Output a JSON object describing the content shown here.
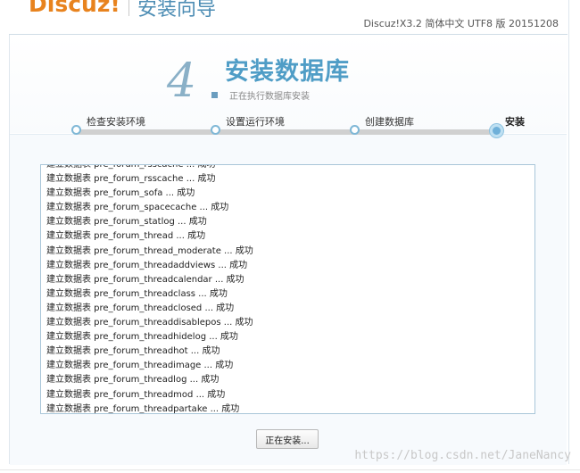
{
  "header": {
    "logo": "Discuz!",
    "title": "安装向导",
    "version": "Discuz!X3.2 简体中文 UTF8 版 20151208"
  },
  "step": {
    "number": "4",
    "title": "安装数据库",
    "subtitle": "正在执行数据库安装"
  },
  "progress": {
    "steps": [
      "检查安装环境",
      "设置运行环境",
      "创建数据库",
      "安装"
    ],
    "current_step": 4
  },
  "log": {
    "lines": [
      "建立数据表 pre_forum_rsscache ... 成功",
      "建立数据表 pre_forum_rsscache ... 成功",
      "建立数据表 pre_forum_sofa ... 成功",
      "建立数据表 pre_forum_spacecache ... 成功",
      "建立数据表 pre_forum_statlog ... 成功",
      "建立数据表 pre_forum_thread ... 成功",
      "建立数据表 pre_forum_thread_moderate ... 成功",
      "建立数据表 pre_forum_threadaddviews ... 成功",
      "建立数据表 pre_forum_threadcalendar ... 成功",
      "建立数据表 pre_forum_threadclass ... 成功",
      "建立数据表 pre_forum_threadclosed ... 成功",
      "建立数据表 pre_forum_threaddisablepos ... 成功",
      "建立数据表 pre_forum_threadhidelog ... 成功",
      "建立数据表 pre_forum_threadhot ... 成功",
      "建立数据表 pre_forum_threadimage ... 成功",
      "建立数据表 pre_forum_threadlog ... 成功",
      "建立数据表 pre_forum_threadmod ... 成功",
      "建立数据表 pre_forum_threadpartake ... 成功"
    ]
  },
  "button": {
    "installing_label": "正在安装..."
  },
  "watermark": "https://blog.csdn.net/JaneNancy",
  "colors": {
    "logo": "#e8831e",
    "accent": "#4f9dc6",
    "border": "#a9c6d9"
  }
}
